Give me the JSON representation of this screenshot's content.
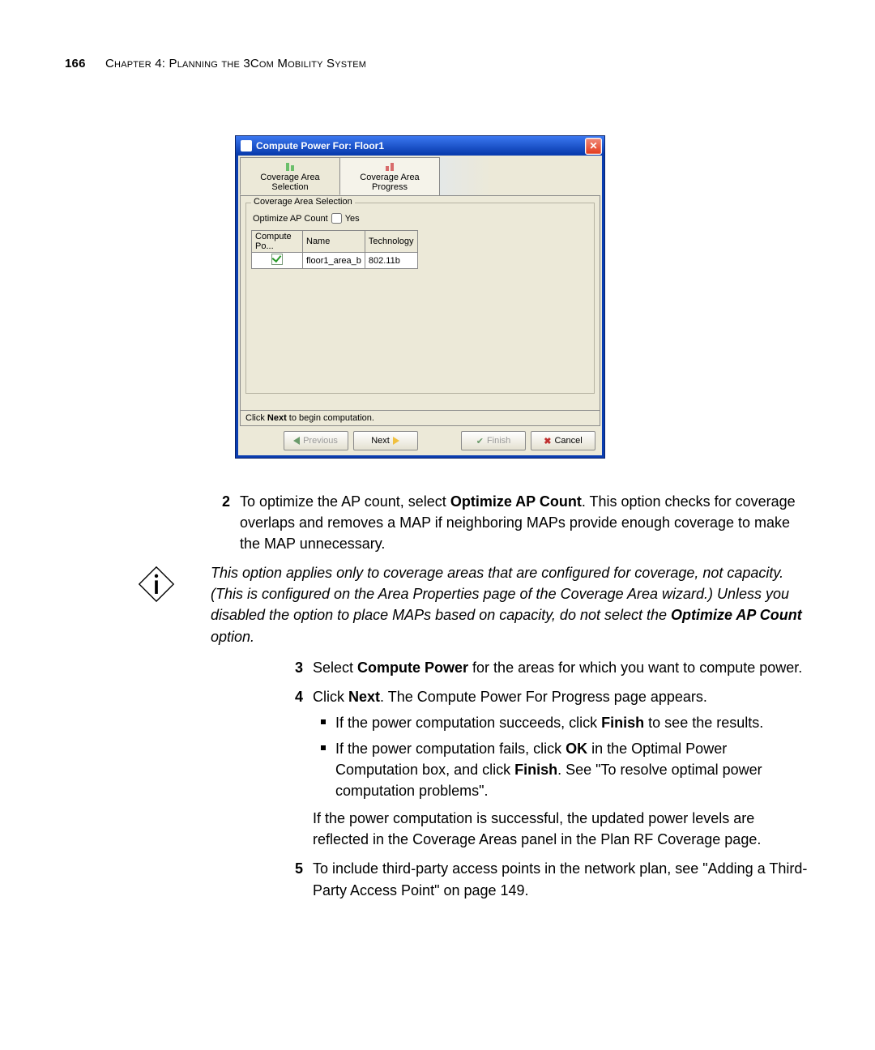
{
  "header": {
    "page_number": "166",
    "chapter": "Chapter 4: Planning the 3Com Mobility System"
  },
  "dialog": {
    "title": "Compute Power For: Floor1",
    "tabs": [
      "Coverage Area Selection",
      "Coverage Area Progress"
    ],
    "group_title": "Coverage Area Selection",
    "optimize_label": "Optimize AP Count",
    "optimize_value": "Yes",
    "table": {
      "headers": [
        "Compute Po...",
        "Name",
        "Technology"
      ],
      "rows": [
        {
          "checked": true,
          "name": "floor1_area_b",
          "tech": "802.11b"
        }
      ]
    },
    "status": "Click Next to begin computation.",
    "status_bold": "Next",
    "buttons": {
      "previous": "Previous",
      "next": "Next",
      "finish": "Finish",
      "cancel": "Cancel"
    }
  },
  "steps": {
    "s2a": "To optimize the AP count, select ",
    "s2b": "Optimize AP Count",
    "s2c": ". This option checks for coverage overlaps and removes a MAP if neighboring MAPs provide enough coverage to make the MAP unnecessary.",
    "note1": "This option applies only to coverage areas that are configured for coverage, not capacity. (This is configured on the Area Properties page of the Coverage Area wizard.) Unless you disabled the option to place MAPs based on capacity, do not select the ",
    "note1b": "Optimize AP Count",
    "note1c": " option.",
    "s3a": "Select ",
    "s3b": "Compute Power",
    "s3c": " for the areas for which you want to compute power.",
    "s4a": "Click ",
    "s4b": "Next",
    "s4c": ". The Compute Power For Progress page appears.",
    "b1a": "If the power computation succeeds, click ",
    "b1b": "Finish",
    "b1c": " to see the results.",
    "b2a": "If the power computation fails, click ",
    "b2b": "OK",
    "b2c": " in the Optimal Power Computation box, and click ",
    "b2d": "Finish",
    "b2e": ". See \"To resolve optimal power computation problems\".",
    "s4f": "If the power computation is successful, the updated power levels are reflected in the Coverage Areas panel in the Plan RF Coverage page.",
    "s5": "To include third-party access points in the network plan, see \"Adding a Third-Party Access Point\" on page 149."
  }
}
